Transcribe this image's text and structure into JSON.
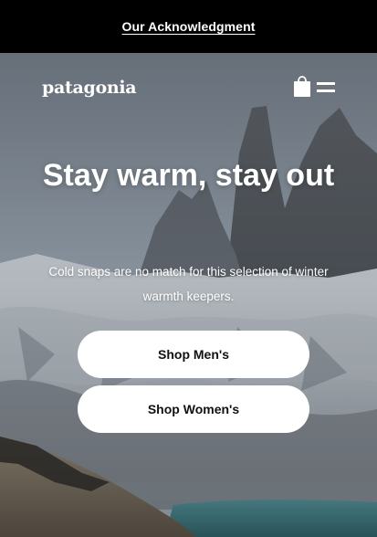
{
  "announcement": {
    "link_label": "Our Acknowledgment"
  },
  "header": {
    "logo_text": "patagonia",
    "cart_icon": "shopping-bag-icon",
    "menu_icon": "hamburger-menu-icon"
  },
  "hero": {
    "headline": "Stay warm, stay out",
    "subtext": "Cold snaps are no match for this selection of winter warmth keepers.",
    "buttons": [
      {
        "label": "Shop Men's"
      },
      {
        "label": "Shop Women's"
      }
    ]
  },
  "colors": {
    "top_bar": "#000000",
    "button_bg": "#ffffff",
    "button_text": "#111111",
    "text": "#ffffff"
  }
}
